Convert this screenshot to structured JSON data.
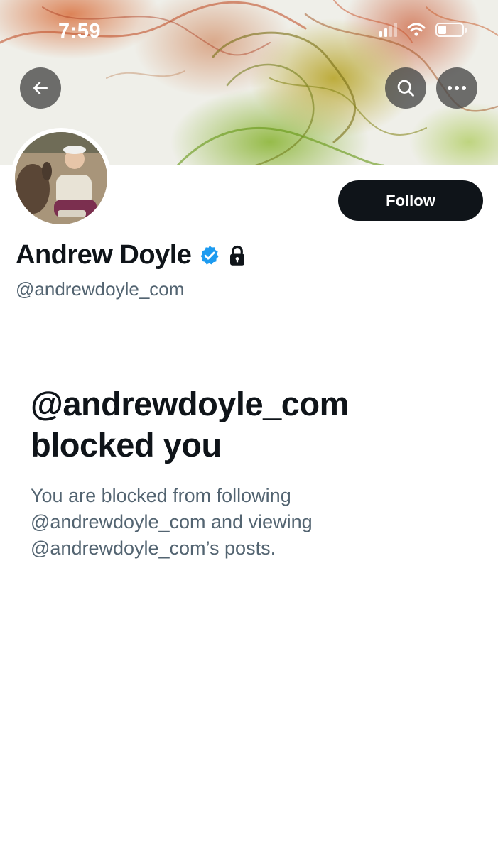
{
  "status_bar": {
    "time": "7:59"
  },
  "header": {
    "back_icon": "arrow-left-icon",
    "search_icon": "search-icon",
    "more_icon": "more-horizontal-icon"
  },
  "profile": {
    "display_name": "Andrew Doyle",
    "handle": "@andrewdoyle_com",
    "verified_icon": "verified-badge-icon",
    "protected_icon": "lock-icon",
    "follow_label": "Follow"
  },
  "blocked_notice": {
    "title_line1": "@andrewdoyle_com",
    "title_line2": "blocked you",
    "body_line1": "You are blocked from following",
    "body_line2": "@andrewdoyle_com and viewing",
    "body_line3": "@andrewdoyle_com’s posts."
  },
  "colors": {
    "text_primary": "#0f1419",
    "text_secondary": "#536471",
    "verified_blue": "#1d9bf0",
    "button_dark": "#0f1419"
  }
}
